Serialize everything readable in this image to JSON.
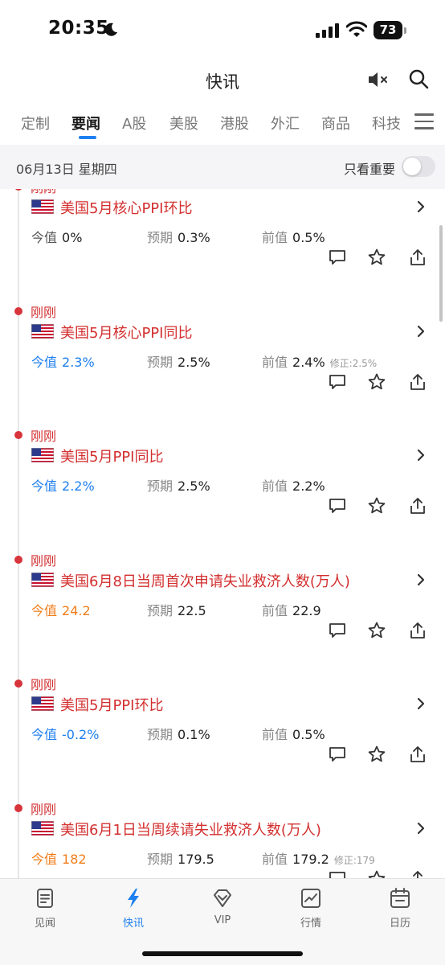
{
  "status_bar": {
    "time": "20:35",
    "battery": "73"
  },
  "header": {
    "title": "快讯"
  },
  "tabs": [
    "定制",
    "要闻",
    "A股",
    "美股",
    "港股",
    "外汇",
    "商品",
    "科技"
  ],
  "date_bar": {
    "date": "06月13日 星期四",
    "important_only_label": "只看重要",
    "important_only_on": false
  },
  "news": [
    {
      "time": "刚刚",
      "title": "美国5月核心PPI环比",
      "actual_label": "今值",
      "actual": "0%",
      "actual_style": "neutral",
      "expected_label": "预期",
      "expected": "0.3%",
      "previous_label": "前值",
      "previous": "0.5%",
      "revision": ""
    },
    {
      "time": "刚刚",
      "title": "美国5月核心PPI同比",
      "actual_label": "今值",
      "actual": "2.3%",
      "actual_style": "blue",
      "expected_label": "预期",
      "expected": "2.5%",
      "previous_label": "前值",
      "previous": "2.4%",
      "revision": "修正:2.5%"
    },
    {
      "time": "刚刚",
      "title": "美国5月PPI同比",
      "actual_label": "今值",
      "actual": "2.2%",
      "actual_style": "blue",
      "expected_label": "预期",
      "expected": "2.5%",
      "previous_label": "前值",
      "previous": "2.2%",
      "revision": ""
    },
    {
      "time": "刚刚",
      "title": "美国6月8日当周首次申请失业救济人数(万人)",
      "actual_label": "今值",
      "actual": "24.2",
      "actual_style": "orange",
      "expected_label": "预期",
      "expected": "22.5",
      "previous_label": "前值",
      "previous": "22.9",
      "revision": ""
    },
    {
      "time": "刚刚",
      "title": "美国5月PPI环比",
      "actual_label": "今值",
      "actual": "-0.2%",
      "actual_style": "blue",
      "expected_label": "预期",
      "expected": "0.1%",
      "previous_label": "前值",
      "previous": "0.5%",
      "revision": ""
    },
    {
      "time": "刚刚",
      "title": "美国6月1日当周续请失业救济人数(万人)",
      "actual_label": "今值",
      "actual": "182",
      "actual_style": "orange",
      "expected_label": "预期",
      "expected": "179.5",
      "previous_label": "前值",
      "previous": "179.2",
      "revision": "修正:179"
    }
  ],
  "bottom_nav": [
    {
      "label": "见闻",
      "icon": "document-icon"
    },
    {
      "label": "快讯",
      "icon": "lightning-icon"
    },
    {
      "label": "VIP",
      "icon": "diamond-icon"
    },
    {
      "label": "行情",
      "icon": "chart-icon"
    },
    {
      "label": "日历",
      "icon": "calendar-icon"
    }
  ],
  "colors": {
    "accent": "#1e7ff0",
    "news_red": "#d32f2f",
    "up_orange": "#f07d1a"
  }
}
